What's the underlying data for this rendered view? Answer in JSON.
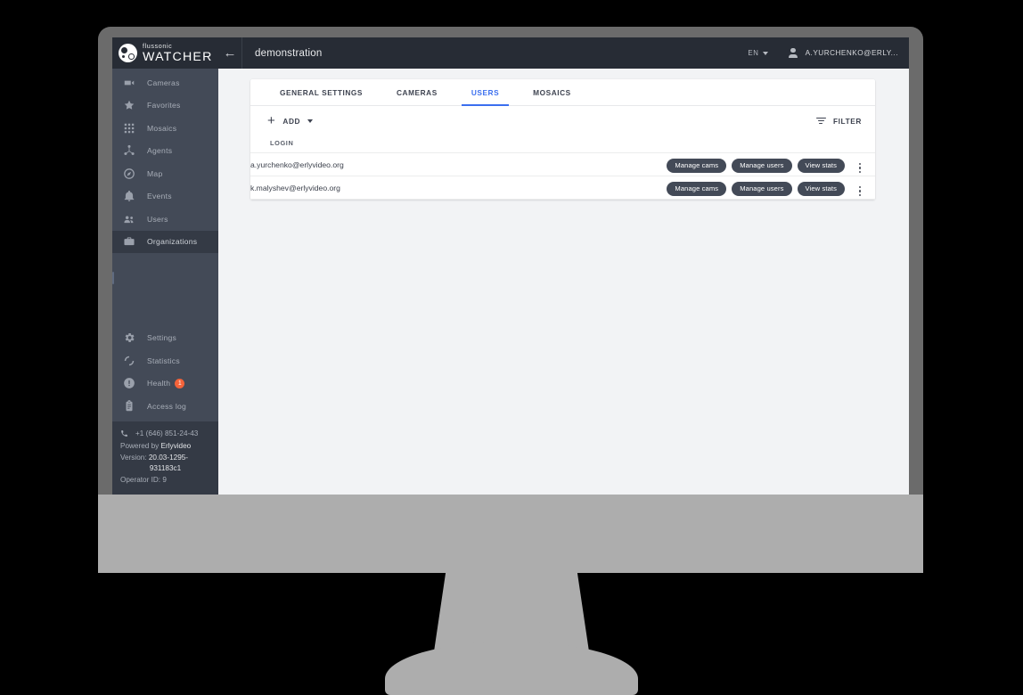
{
  "app": {
    "logo_sub": "flussonic",
    "logo_main": "WATCHER",
    "back_icon": "←",
    "project_title": "demonstration",
    "language": "EN",
    "user_name": "A.YURCHENKO@ERLY...",
    "accent_color": "#3b6fef",
    "sidebar_bg": "#434a57",
    "topbar_bg": "#272c35",
    "badge_color": "#f4633a"
  },
  "sidebar": {
    "items": [
      {
        "label": "Cameras",
        "icon": "video-camera-icon",
        "active": false,
        "badge": ""
      },
      {
        "label": "Favorites",
        "icon": "star-icon",
        "active": false,
        "badge": ""
      },
      {
        "label": "Mosaics",
        "icon": "grid-icon",
        "active": false,
        "badge": ""
      },
      {
        "label": "Agents",
        "icon": "agents-icon",
        "active": false,
        "badge": ""
      },
      {
        "label": "Map",
        "icon": "compass-icon",
        "active": false,
        "badge": ""
      },
      {
        "label": "Events",
        "icon": "bell-icon",
        "active": false,
        "badge": ""
      },
      {
        "label": "Users",
        "icon": "users-icon",
        "active": false,
        "badge": ""
      },
      {
        "label": "Organizations",
        "icon": "briefcase-icon",
        "active": true,
        "badge": ""
      }
    ],
    "bottom_items": [
      {
        "label": "Settings",
        "icon": "gear-icon",
        "badge": ""
      },
      {
        "label": "Statistics",
        "icon": "donut-icon",
        "badge": ""
      },
      {
        "label": "Health",
        "icon": "info-icon",
        "badge": "1"
      },
      {
        "label": "Access log",
        "icon": "clipboard-icon",
        "badge": ""
      }
    ],
    "footer": {
      "phone_icon": "phone-icon",
      "phone": "+1 (646) 851-24-43",
      "powered_by_label": "Powered by",
      "powered_by_value": "Erlyvideo",
      "version_label": "Version:",
      "version_value": "20.03-1295-",
      "version_value2": "931183c1",
      "operator": "Operator ID: 9"
    }
  },
  "main": {
    "tabs": [
      {
        "label": "GENERAL SETTINGS",
        "active": false
      },
      {
        "label": "CAMERAS",
        "active": false
      },
      {
        "label": "USERS",
        "active": true
      },
      {
        "label": "MOSAICS",
        "active": false
      }
    ],
    "toolbar": {
      "add_label": "ADD",
      "add_icon": "plus-icon",
      "add_caret": "caret-down-icon",
      "filter_label": "FILTER",
      "filter_icon": "filter-icon"
    },
    "table": {
      "columns": [
        "LOGIN"
      ],
      "rows": [
        {
          "login": "a.yurchenko@erlyvideo.org",
          "actions": [
            "Manage cams",
            "Manage users",
            "View stats"
          ],
          "menu_icon": "kebab-menu-icon"
        },
        {
          "login": "k.malyshev@erlyvideo.org",
          "actions": [
            "Manage cams",
            "Manage users",
            "View stats"
          ],
          "menu_icon": "kebab-menu-icon"
        }
      ]
    }
  }
}
